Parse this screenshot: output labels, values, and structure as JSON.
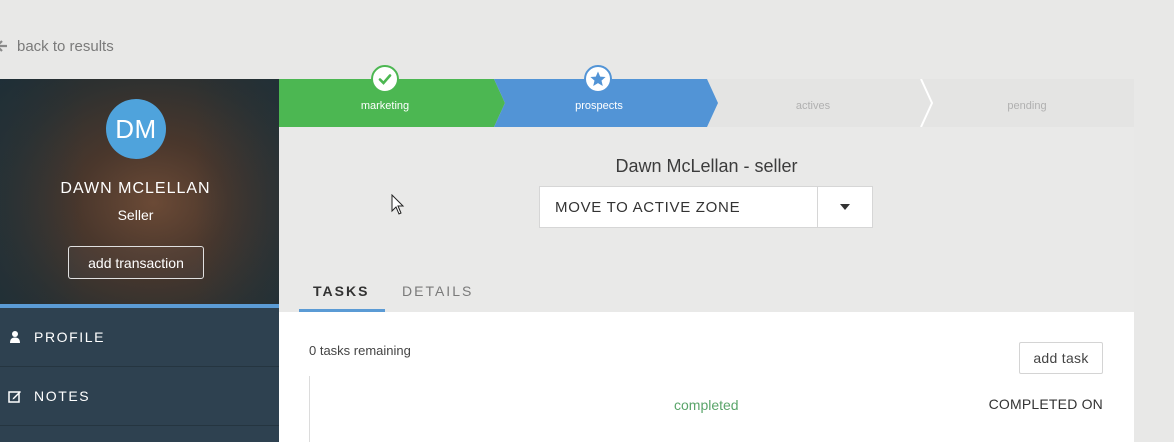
{
  "nav": {
    "back_label": "back to results"
  },
  "profile": {
    "initials": "DM",
    "name": "DAWN MCLELLAN",
    "role": "Seller",
    "add_transaction_label": "add transaction",
    "avatar_color": "#4fa3dc"
  },
  "sidebar": {
    "items": [
      {
        "label": "PROFILE",
        "icon": "person-icon"
      },
      {
        "label": "NOTES",
        "icon": "edit-note-icon"
      }
    ]
  },
  "steps": [
    {
      "label": "marketing",
      "state": "done",
      "color": "#4cb752"
    },
    {
      "label": "prospects",
      "state": "current",
      "color": "#5294d6"
    },
    {
      "label": "actives",
      "state": "upcoming",
      "color": "#e4e4e3"
    },
    {
      "label": "pending",
      "state": "upcoming",
      "color": "#e4e4e3"
    }
  ],
  "main": {
    "contact_title": "Dawn McLellan - seller",
    "zone_select_value": "MOVE TO ACTIVE ZONE",
    "tabs": [
      {
        "label": "TASKS",
        "active": true
      },
      {
        "label": "DETAILS",
        "active": false
      }
    ]
  },
  "tasks": {
    "remaining_text": "0 tasks remaining",
    "add_task_label": "add task",
    "col_completed": "completed",
    "col_completed_on": "COMPLETED ON"
  }
}
